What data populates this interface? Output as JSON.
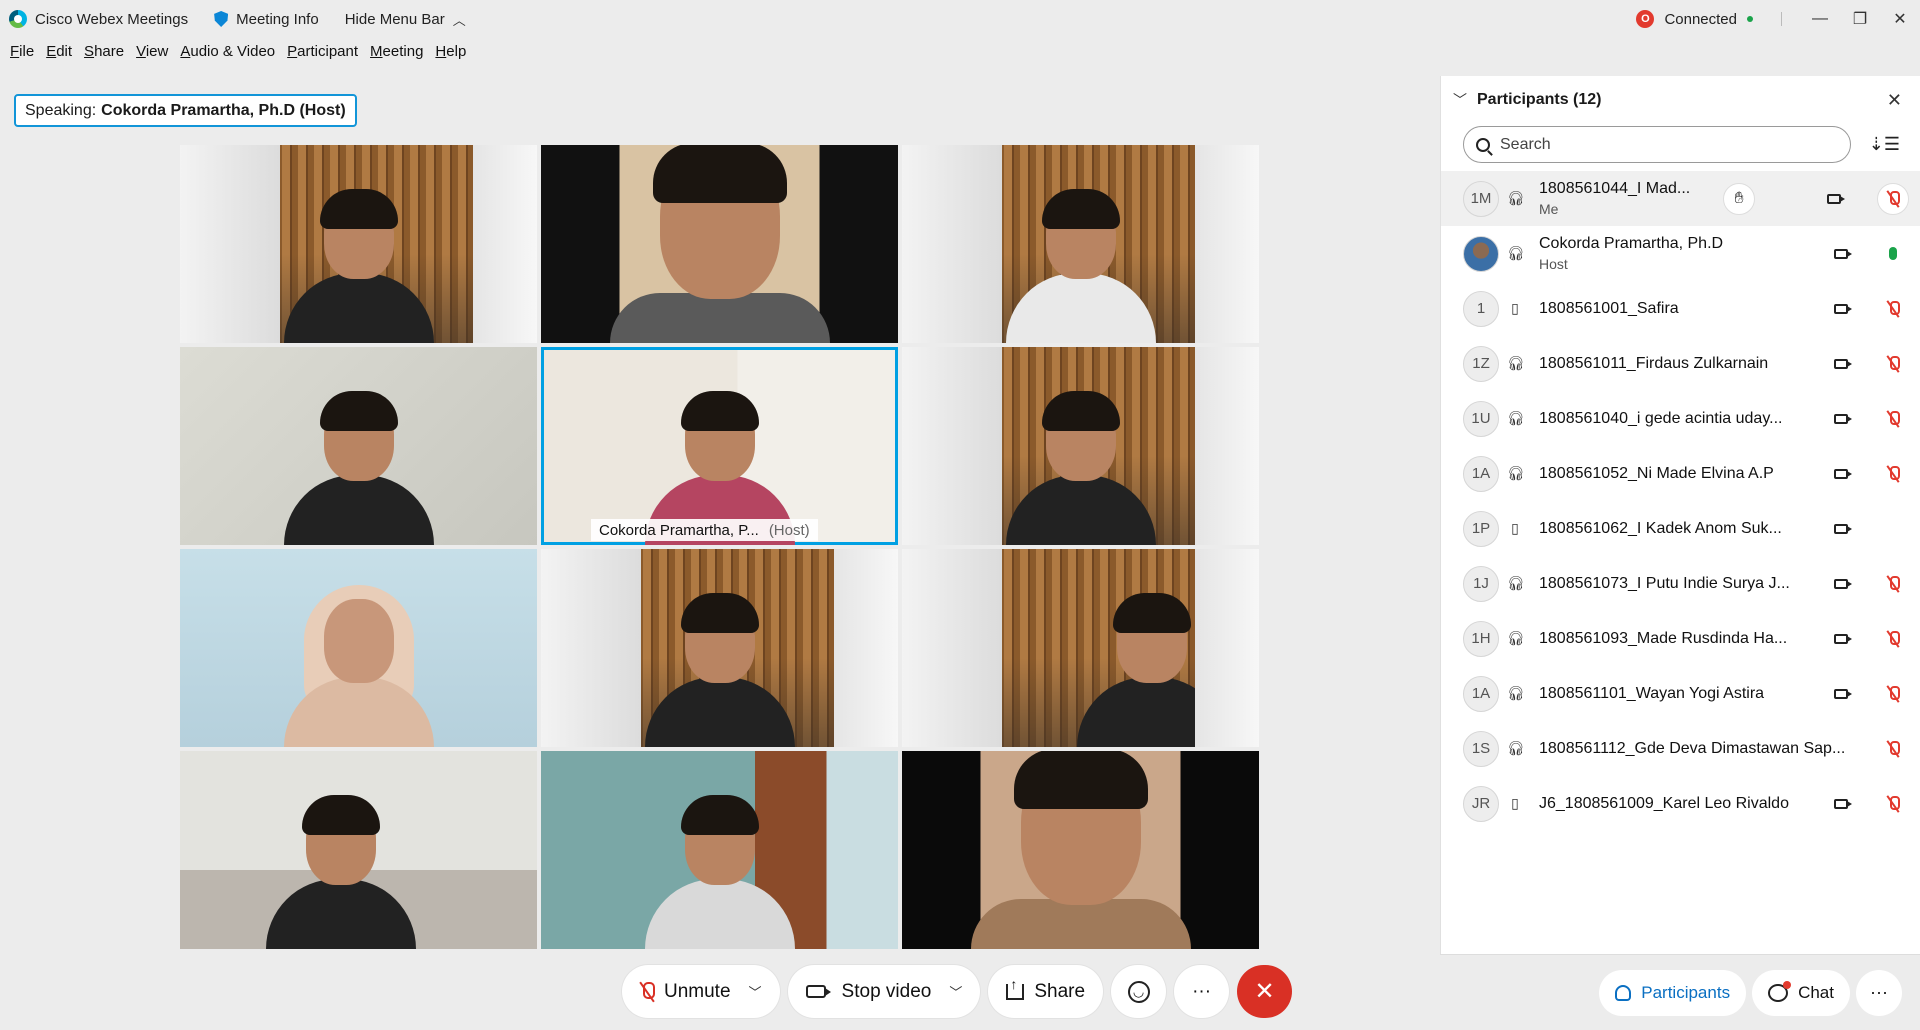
{
  "titlebar": {
    "app_name": "Cisco Webex Meetings",
    "meeting_info": "Meeting Info",
    "hide_menu": "Hide Menu Bar",
    "connection_icon_letter": "O",
    "connection_status": "Connected"
  },
  "menu": [
    "File",
    "Edit",
    "Share",
    "View",
    "Audio & Video",
    "Participant",
    "Meeting",
    "Help"
  ],
  "speaking": {
    "label": "Speaking:",
    "name": "Cokorda Pramartha, Ph.D (Host)"
  },
  "active_tile": {
    "name": "Cokorda Pramartha, P...",
    "role": "(Host)"
  },
  "controls": {
    "unmute": "Unmute",
    "stop_video": "Stop video",
    "share": "Share",
    "more": "···",
    "leave": "✕"
  },
  "panel": {
    "title": "Participants (12)",
    "search_placeholder": "Search",
    "participants": [
      {
        "initials": "1M",
        "name": "1808561044_I Mad...",
        "sub": "Me",
        "device": "headset",
        "mic": "muted"
      },
      {
        "initials": "",
        "name": "Cokorda Pramartha, Ph.D",
        "sub": "Host",
        "device": "headset",
        "mic": "on"
      },
      {
        "initials": "1",
        "name": "1808561001_Safira",
        "sub": "",
        "device": "phone",
        "mic": "muted"
      },
      {
        "initials": "1Z",
        "name": "1808561011_Firdaus Zulkarnain",
        "sub": "",
        "device": "headset",
        "mic": "muted"
      },
      {
        "initials": "1U",
        "name": "1808561040_i gede acintia uday...",
        "sub": "",
        "device": "headset",
        "mic": "muted"
      },
      {
        "initials": "1A",
        "name": "1808561052_Ni Made Elvina A.P",
        "sub": "",
        "device": "headset",
        "mic": "muted"
      },
      {
        "initials": "1P",
        "name": "1808561062_I Kadek Anom Suk...",
        "sub": "",
        "device": "phone",
        "mic": "none"
      },
      {
        "initials": "1J",
        "name": "1808561073_I Putu Indie Surya J...",
        "sub": "",
        "device": "headset",
        "mic": "muted"
      },
      {
        "initials": "1H",
        "name": "1808561093_Made Rusdinda Ha...",
        "sub": "",
        "device": "headset",
        "mic": "muted"
      },
      {
        "initials": "1A",
        "name": "1808561101_Wayan Yogi Astira",
        "sub": "",
        "device": "headset",
        "mic": "muted"
      },
      {
        "initials": "1S",
        "name": "1808561112_Gde Deva Dimastawan Sap...",
        "sub": "",
        "device": "headset",
        "mic": "muted"
      },
      {
        "initials": "JR",
        "name": "J6_1808561009_Karel Leo Rivaldo",
        "sub": "",
        "device": "phone",
        "mic": "muted"
      }
    ]
  },
  "bottom_tabs": {
    "participants": "Participants",
    "chat": "Chat",
    "more": "···"
  },
  "colors": {
    "accent": "#1295d8",
    "leave": "#d93025",
    "muted": "#e23a2e",
    "connected": "#1aa34a"
  }
}
